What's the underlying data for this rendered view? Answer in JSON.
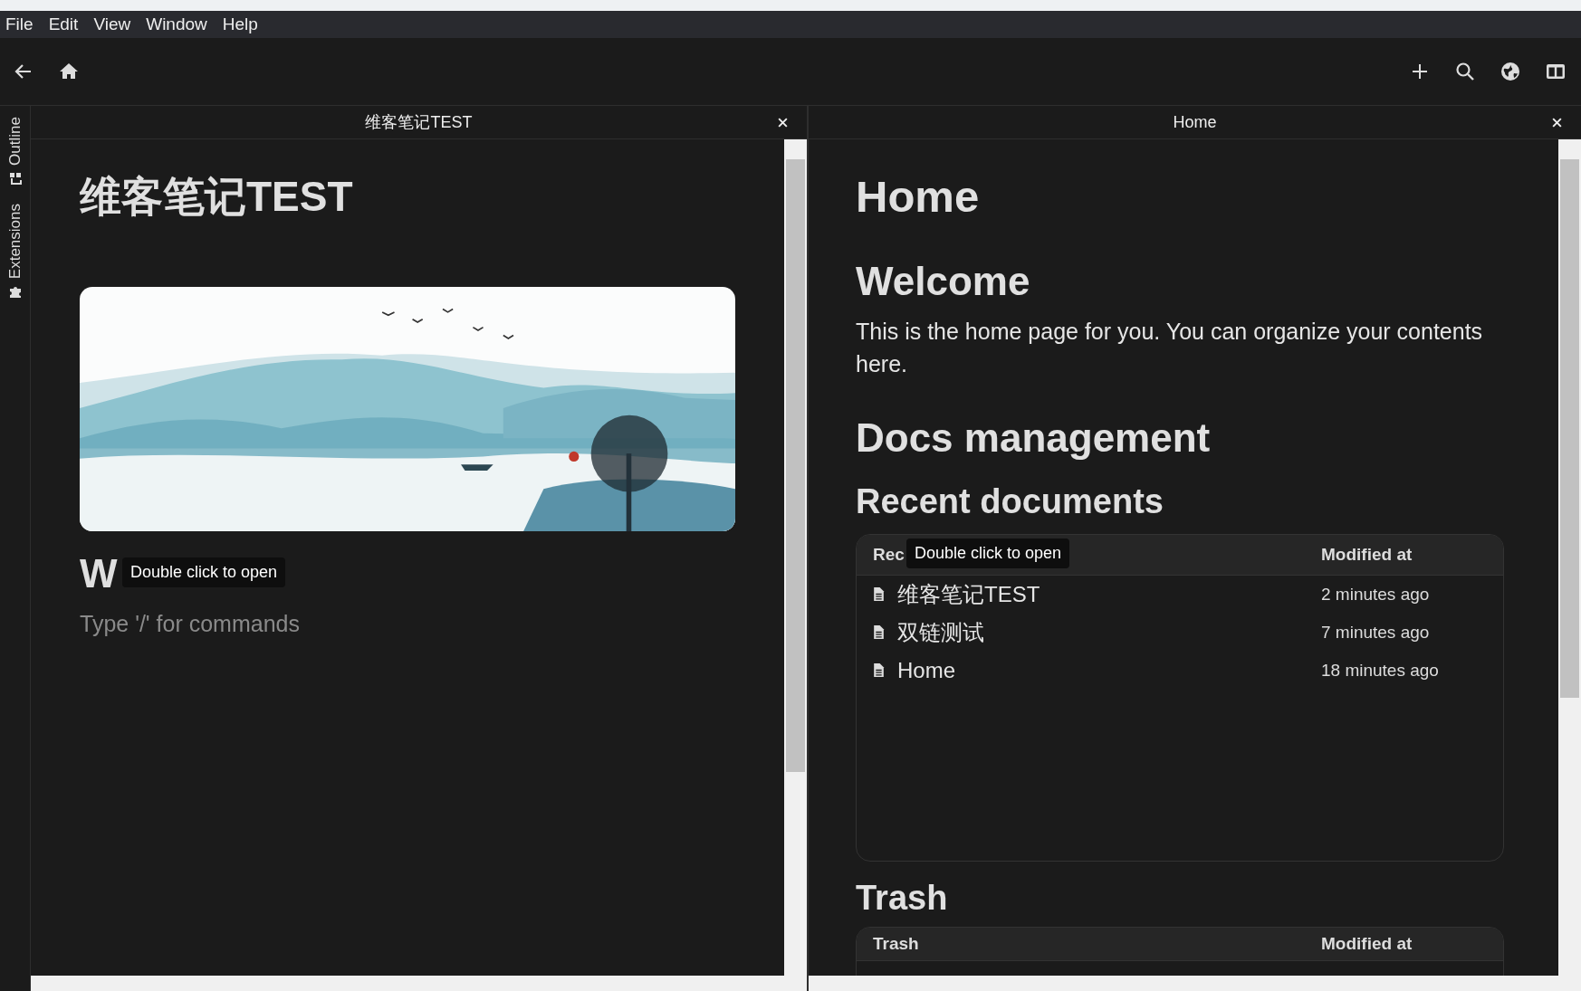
{
  "menu": [
    "File",
    "Edit",
    "View",
    "Window",
    "Help"
  ],
  "sidebar": [
    "Outline",
    "Extensions"
  ],
  "left_pane": {
    "tab": "维客笔记TEST",
    "title": "维客笔记TEST",
    "heading": "W",
    "tooltip": "Double click to open",
    "placeholder": "Type '/' for commands"
  },
  "right_pane": {
    "tab": "Home",
    "title": "Home",
    "welcome_heading": "Welcome",
    "welcome_text": "This is the home page for you. You can organize your contents here.",
    "docs_heading": "Docs management",
    "recent_heading": "Recent documents",
    "recent_table": {
      "columns": [
        "Rec",
        "Modified at"
      ],
      "tooltip": "Double click to open",
      "rows": [
        {
          "name": "维客笔记TEST",
          "modified": "2 minutes ago"
        },
        {
          "name": "双链测试",
          "modified": "7 minutes ago"
        },
        {
          "name": "Home",
          "modified": "18 minutes ago"
        }
      ]
    },
    "trash_heading": "Trash",
    "trash_table": {
      "columns": [
        "Trash",
        "Modified at"
      ]
    }
  }
}
